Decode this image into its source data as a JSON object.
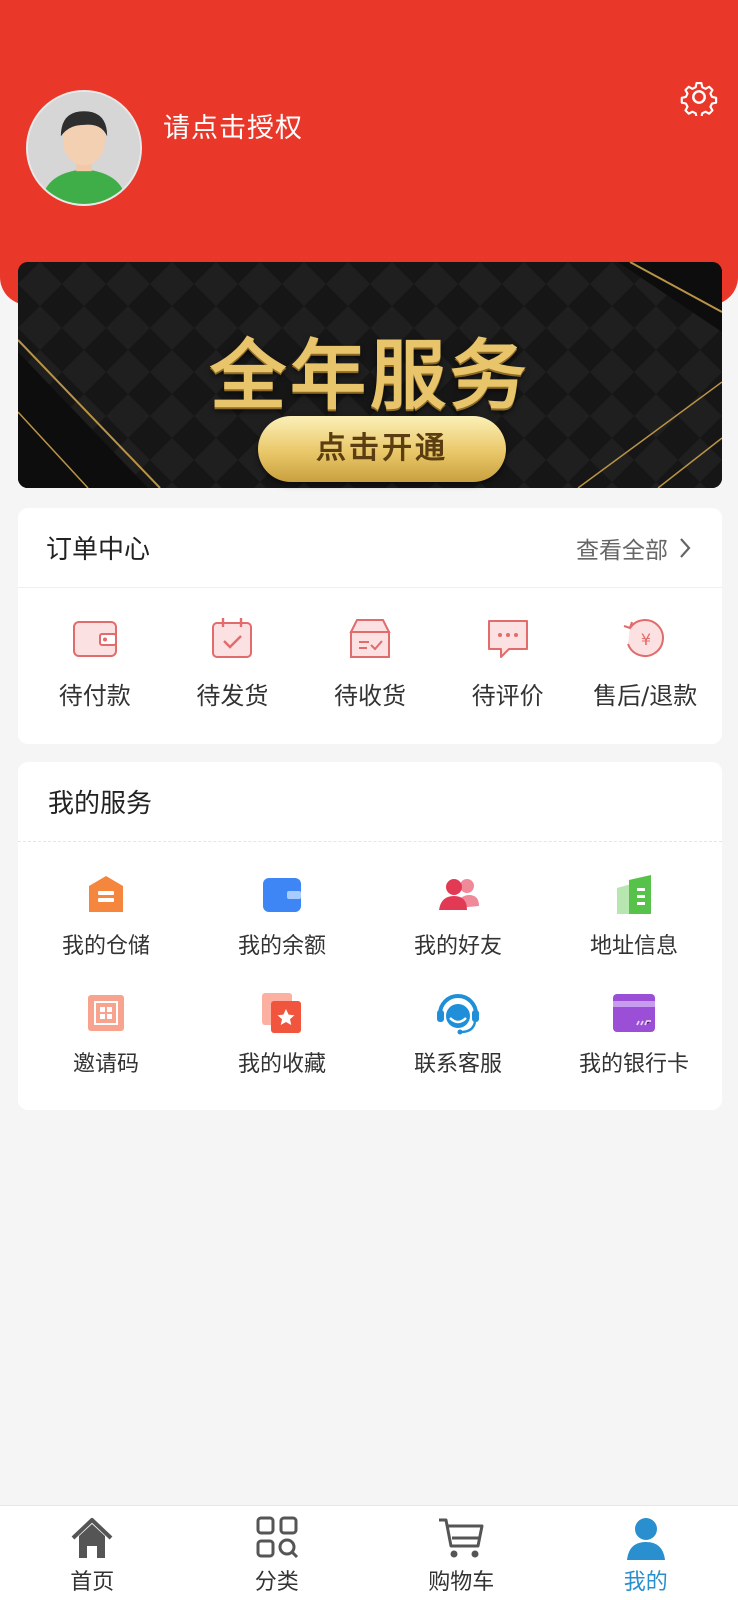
{
  "header": {
    "auth_prompt": "请点击授权",
    "avatar_icon": "default-avatar-icon",
    "settings_icon": "gear-icon",
    "background_color": "#e9372a"
  },
  "banner": {
    "title": "全年服务",
    "button_label": "点击开通"
  },
  "orders": {
    "title": "订单中心",
    "view_all": "查看全部",
    "items": [
      {
        "label": "待付款",
        "icon": "wallet-icon"
      },
      {
        "label": "待发货",
        "icon": "calendar-check-icon"
      },
      {
        "label": "待收货",
        "icon": "box-icon"
      },
      {
        "label": "待评价",
        "icon": "comment-icon"
      },
      {
        "label": "售后/退款",
        "icon": "refund-icon"
      }
    ]
  },
  "services": {
    "title": "我的服务",
    "items": [
      {
        "label": "我的仓储",
        "icon": "warehouse-icon"
      },
      {
        "label": "我的余额",
        "icon": "balance-wallet-icon"
      },
      {
        "label": "我的好友",
        "icon": "friends-icon"
      },
      {
        "label": "地址信息",
        "icon": "address-book-icon"
      },
      {
        "label": "邀请码",
        "icon": "qr-code-icon"
      },
      {
        "label": "我的收藏",
        "icon": "favorites-star-icon"
      },
      {
        "label": "联系客服",
        "icon": "customer-service-icon"
      },
      {
        "label": "我的银行卡",
        "icon": "bank-card-icon"
      }
    ]
  },
  "tabbar": {
    "items": [
      {
        "label": "首页",
        "icon": "home-icon"
      },
      {
        "label": "分类",
        "icon": "category-grid-icon"
      },
      {
        "label": "购物车",
        "icon": "cart-icon"
      },
      {
        "label": "我的",
        "icon": "user-icon"
      }
    ],
    "active_index": 3,
    "active_color": "#2a8fcf"
  }
}
